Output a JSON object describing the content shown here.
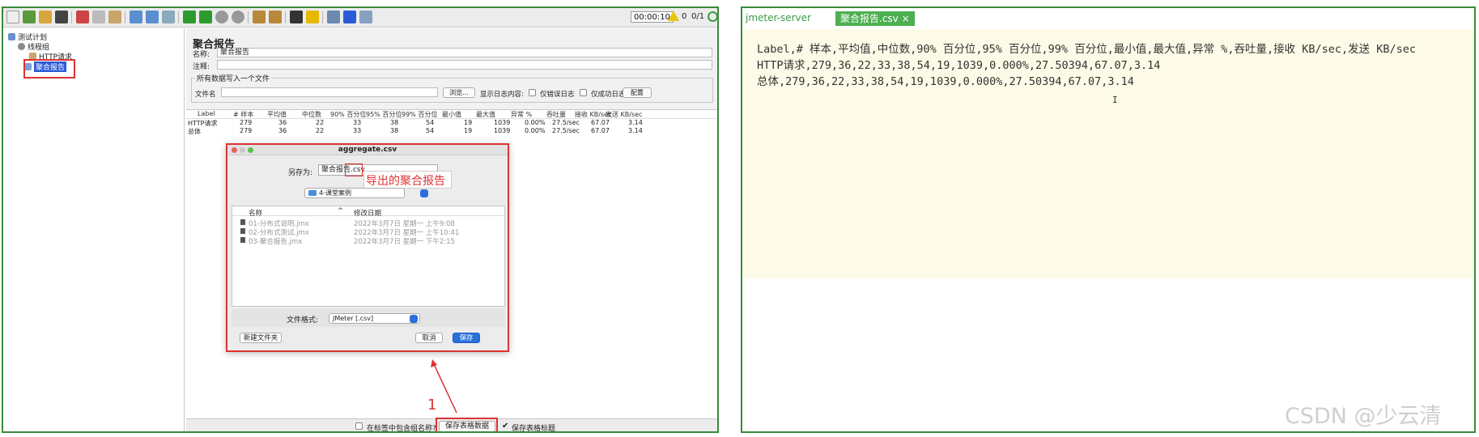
{
  "left": {
    "toolbar": {
      "timer": "00:00:10",
      "warnings": "0",
      "threads": "0/1"
    },
    "tree": {
      "items": [
        {
          "label": "测试计划"
        },
        {
          "label": "线程组"
        },
        {
          "label": "HTTP请求"
        },
        {
          "label": "聚合报告"
        }
      ]
    },
    "main": {
      "title": "聚合报告",
      "name_label": "名称:",
      "name_value": "聚合报告",
      "comment_label": "注释:",
      "group_legend": "所有数据写入一个文件",
      "filename_label": "文件名",
      "browse_btn": "浏览...",
      "log_content_label": "显示日志内容:",
      "errors_only": "仅错误日志",
      "success_only": "仅成功日志",
      "config_btn": "配置",
      "table": {
        "headers": [
          "Label",
          "# 样本",
          "平均值",
          "中位数",
          "90% 百分位",
          "95% 百分位",
          "99% 百分位",
          "最小值",
          "最大值",
          "异常 %",
          "吞吐量",
          "接收 KB/sec",
          "发送 KB/sec"
        ],
        "rows": [
          [
            "HTTP请求",
            "279",
            "36",
            "22",
            "33",
            "38",
            "54",
            "19",
            "1039",
            "0.00%",
            "27.5/sec",
            "67.07",
            "3.14"
          ],
          [
            "总体",
            "279",
            "36",
            "22",
            "33",
            "38",
            "54",
            "19",
            "1039",
            "0.00%",
            "27.5/sec",
            "67.07",
            "3.14"
          ]
        ]
      },
      "bottom": {
        "include_group": "在标签中包含组名称?",
        "save_table": "保存表格数据",
        "save_header": "保存表格标题"
      }
    },
    "dialog": {
      "title": "aggregate.csv",
      "save_as_label": "另存为:",
      "save_as_value": "聚合报告.csv",
      "annotation": "导出的聚合报告",
      "folder": "4-课堂案例",
      "col_name": "名称",
      "col_modified": "修改日期",
      "files": [
        {
          "name": "01-分布式说明.jmx",
          "date": "2022年3月7日 星期一 上午9:08"
        },
        {
          "name": "02-分布式测试.jmx",
          "date": "2022年3月7日 星期一 上午10:41"
        },
        {
          "name": "03-聚合报告.jmx",
          "date": "2022年3月7日 星期一 下午2:15"
        }
      ],
      "format_label": "文件格式:",
      "format_value": "JMeter [.csv]",
      "new_folder": "新建文件夹",
      "cancel": "取消",
      "save": "保存"
    },
    "step_number": "1"
  },
  "right": {
    "tab_server": "jmeter-server",
    "tab_file": "聚合报告.csv",
    "lines": [
      "Label,# 样本,平均值,中位数,90% 百分位,95% 百分位,99% 百分位,最小值,最大值,异常 %,吞吐量,接收 KB/sec,发送 KB/sec",
      "HTTP请求,279,36,22,33,38,54,19,1039,0.000%,27.50394,67.07,3.14",
      "总体,279,36,22,33,38,54,19,1039,0.000%,27.50394,67.07,3.14"
    ],
    "watermark": "CSDN @少云清"
  },
  "colors": {
    "frame": "#3a8a3a",
    "highlight": "#d33333",
    "tab_green": "#4caf50",
    "editor_bg": "#fdfbe7",
    "primary_blue": "#2a6fdb"
  }
}
